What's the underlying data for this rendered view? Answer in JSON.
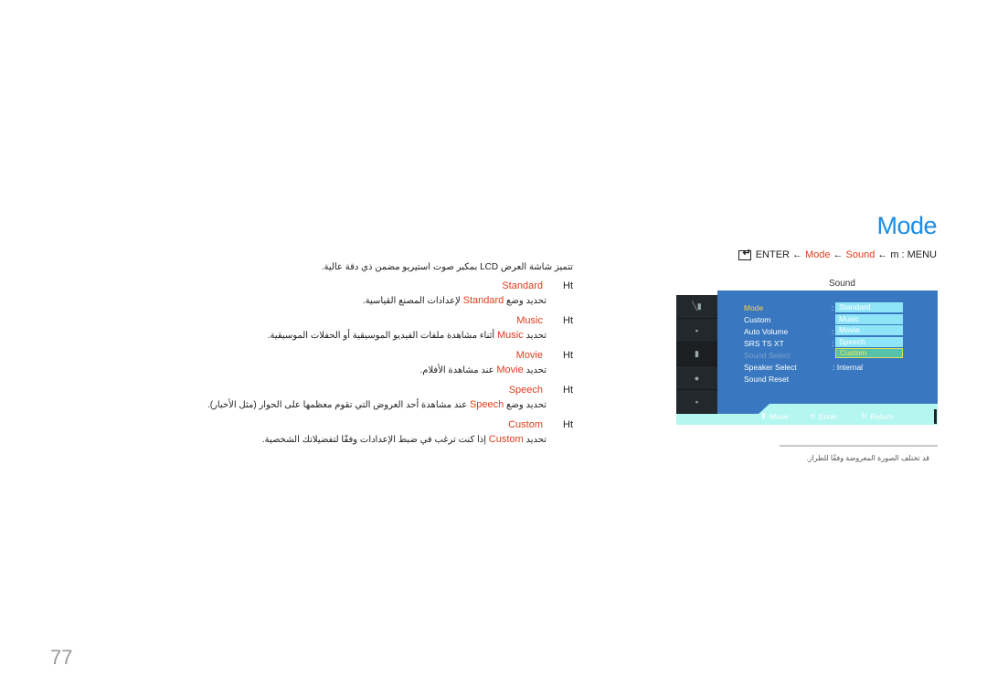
{
  "page": {
    "title": "Mode",
    "page_number": "77"
  },
  "breadcrumb": {
    "enter_icon": "enter-icon",
    "enter_label": "ENTER",
    "arrow": "←",
    "mode": "Mode",
    "sound": "Sound",
    "menu_glyph": "m",
    "menu_label": ": MENU"
  },
  "intro": "تتميز شاشة العرض LCD بمكبر صوت استيريو مضمن ذي دقة عالية.",
  "options": [
    {
      "ht": "Ht",
      "name": "Standard",
      "desc_pre": "تحديد وضع",
      "desc_name": "Standard",
      "desc_post": "لإعدادات المصنع القياسية."
    },
    {
      "ht": "Ht",
      "name": "Music",
      "desc_pre": "تحديد",
      "desc_name": "Music",
      "desc_post": "أثناء مشاهدة ملفات الفيديو الموسيقية أو الحفلات الموسيقية."
    },
    {
      "ht": "Ht",
      "name": "Movie",
      "desc_pre": "تحديد",
      "desc_name": "Movie",
      "desc_post": "عند مشاهدة الأفلام."
    },
    {
      "ht": "Ht",
      "name": "Speech",
      "desc_pre": "تحديد وضع",
      "desc_name": "Speech",
      "desc_post": "عند مشاهدة أحد العروض التي تقوم معظمها على الحوار (مثل الأخبار)."
    },
    {
      "ht": "Ht",
      "name": "Custom",
      "desc_pre": "تحديد",
      "desc_name": "Custom",
      "desc_post": "إذا كنت ترغب في ضبط الإعدادات وفقًا لتفضيلاتك الشخصية."
    }
  ],
  "osd": {
    "caption": "Sound",
    "menu_items": [
      {
        "label": "Mode",
        "state": "active"
      },
      {
        "label": "Custom",
        "state": "normal"
      },
      {
        "label": "Auto Volume",
        "state": "normal"
      },
      {
        "label": "SRS TS XT",
        "state": "normal"
      },
      {
        "label": "Sound Select",
        "state": "disabled"
      },
      {
        "label": "Speaker Select",
        "state": "normal"
      },
      {
        "label": "Sound Reset",
        "state": "normal"
      }
    ],
    "dropdown_options": [
      "Standard",
      "Music",
      "Movie",
      "Speech",
      "Custom"
    ],
    "dropdown_selected": "Custom",
    "speaker_select_value": ": Internal",
    "bottom": {
      "move": "Move",
      "enter": "Enter",
      "return": "Return"
    },
    "colors": {
      "panel": "#3978c0",
      "bar": "#b4f6f0",
      "active_item": "#f5d43a"
    }
  },
  "note": "قد تختلف الصورة المعروضة وفقًا للطراز."
}
